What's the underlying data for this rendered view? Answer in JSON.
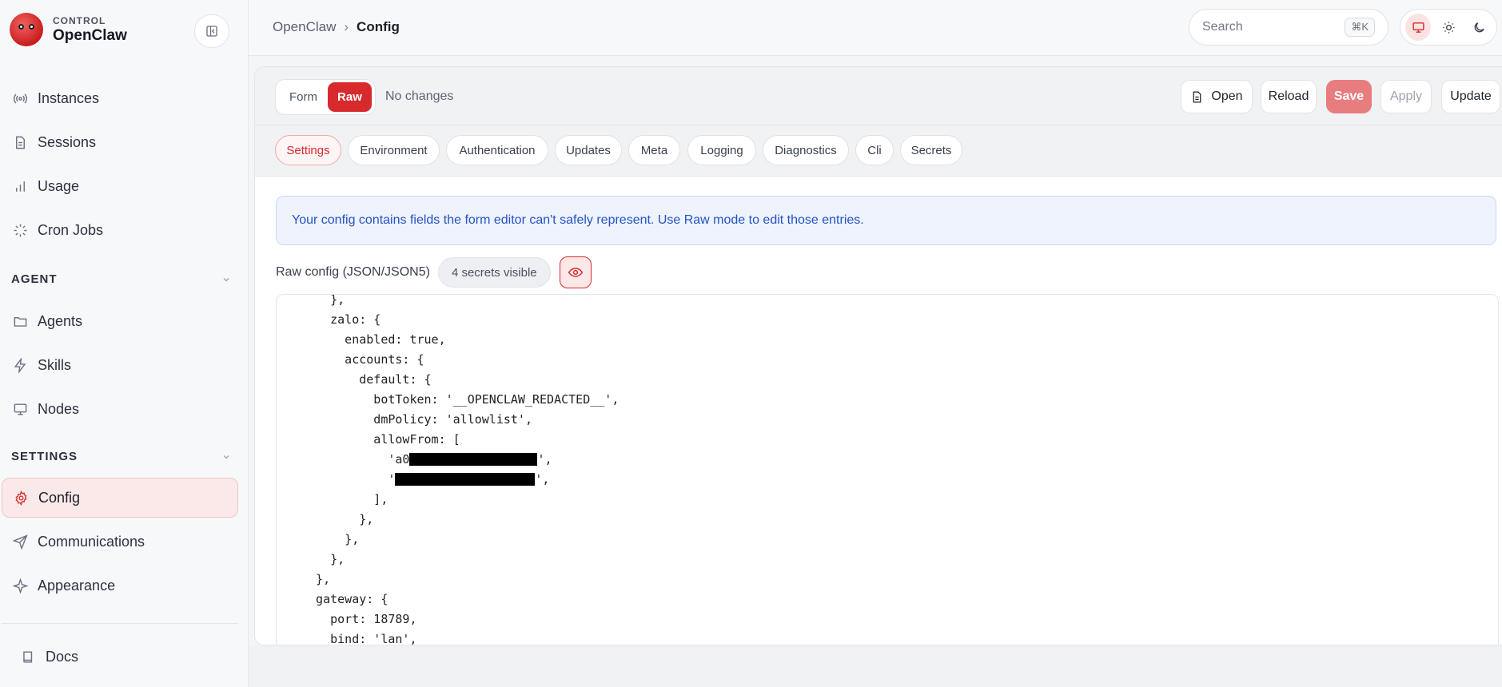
{
  "brand": {
    "small": "CONTROL",
    "name": "OpenClaw"
  },
  "nav": {
    "instances": "Instances",
    "sessions": "Sessions",
    "usage": "Usage",
    "cron": "Cron Jobs",
    "agent_section": "AGENT",
    "agents": "Agents",
    "skills": "Skills",
    "nodes": "Nodes",
    "settings_section": "SETTINGS",
    "config": "Config",
    "communications": "Communications",
    "appearance": "Appearance",
    "docs": "Docs"
  },
  "breadcrumb": {
    "parent": "OpenClaw",
    "sep": "›",
    "current": "Config"
  },
  "search": {
    "placeholder": "Search",
    "shortcut": "⌘K"
  },
  "toolbar": {
    "mode_form": "Form",
    "mode_raw": "Raw",
    "status": "No changes",
    "open": "Open",
    "reload": "Reload",
    "save": "Save",
    "apply": "Apply",
    "update": "Update"
  },
  "tabs": [
    "Settings",
    "Environment",
    "Authentication",
    "Updates",
    "Meta",
    "Logging",
    "Diagnostics",
    "Cli",
    "Secrets"
  ],
  "alert": "Your config contains fields the form editor can't safely represent. Use Raw mode to edit those entries.",
  "raw": {
    "label": "Raw config (JSON/JSON5)",
    "secrets": "4 secrets visible"
  },
  "code_lines": [
    "    },",
    "    zalo: {",
    "      enabled: true,",
    "      accounts: {",
    "        default: {",
    "          botToken: '__OPENCLAW_REDACTED__',",
    "          dmPolicy: 'allowlist',",
    "          allowFrom: [",
    "            'a0",
    "            '",
    "          ],",
    "        },",
    "      },",
    "    },",
    "  },",
    "  gateway: {",
    "    port: 18789,",
    "    bind: 'lan',"
  ],
  "code_tails": {
    "line8": "',",
    "line9": "',"
  },
  "colors": {
    "accent": "#d72a2d",
    "alert_text": "#2452c5"
  }
}
